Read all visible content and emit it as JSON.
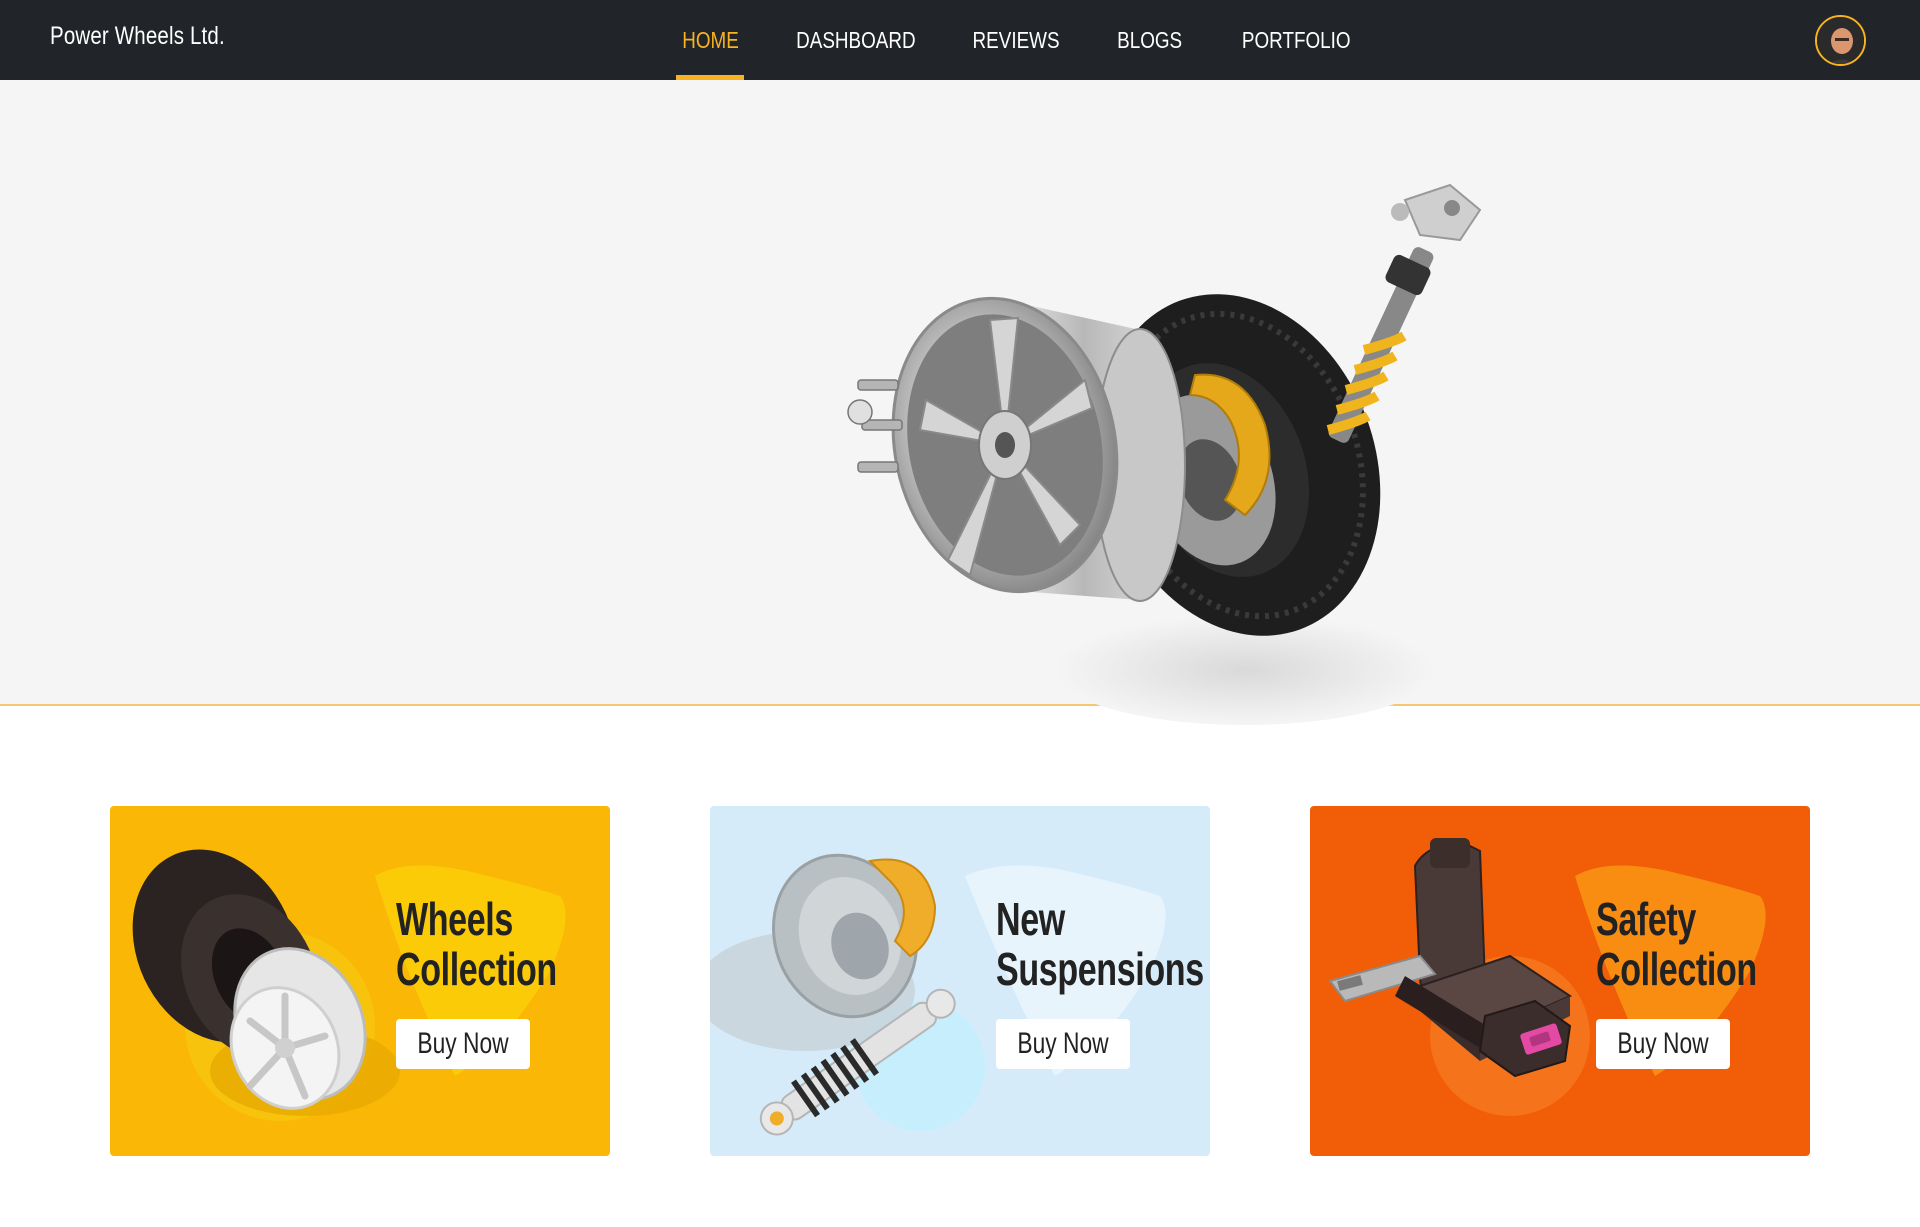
{
  "brand": "Power Wheels Ltd.",
  "nav": {
    "items": [
      {
        "label": "HOME",
        "active": true
      },
      {
        "label": "DASHBOARD",
        "active": false
      },
      {
        "label": "REVIEWS",
        "active": false
      },
      {
        "label": "BLOGS",
        "active": false
      },
      {
        "label": "PORTFOLIO",
        "active": false
      }
    ]
  },
  "colors": {
    "navbar": "#212529",
    "accent": "#f8b321",
    "hero_bg": "#f5f5f5",
    "card_wheels": "#fab705",
    "card_suspensions": "#d6ebfa",
    "card_safety": "#f25d07"
  },
  "cards": [
    {
      "title_line1": "Wheels",
      "title_line2": "Collection",
      "button": "Buy Now",
      "icon": "tire-and-rim-icon"
    },
    {
      "title_line1": "New",
      "title_line2": "Suspensions",
      "button": "Buy Now",
      "icon": "brake-and-shock-absorber-icon"
    },
    {
      "title_line1": "Safety",
      "title_line2": "Collection",
      "button": "Buy Now",
      "icon": "car-seat-and-seatbelt-icon"
    }
  ]
}
